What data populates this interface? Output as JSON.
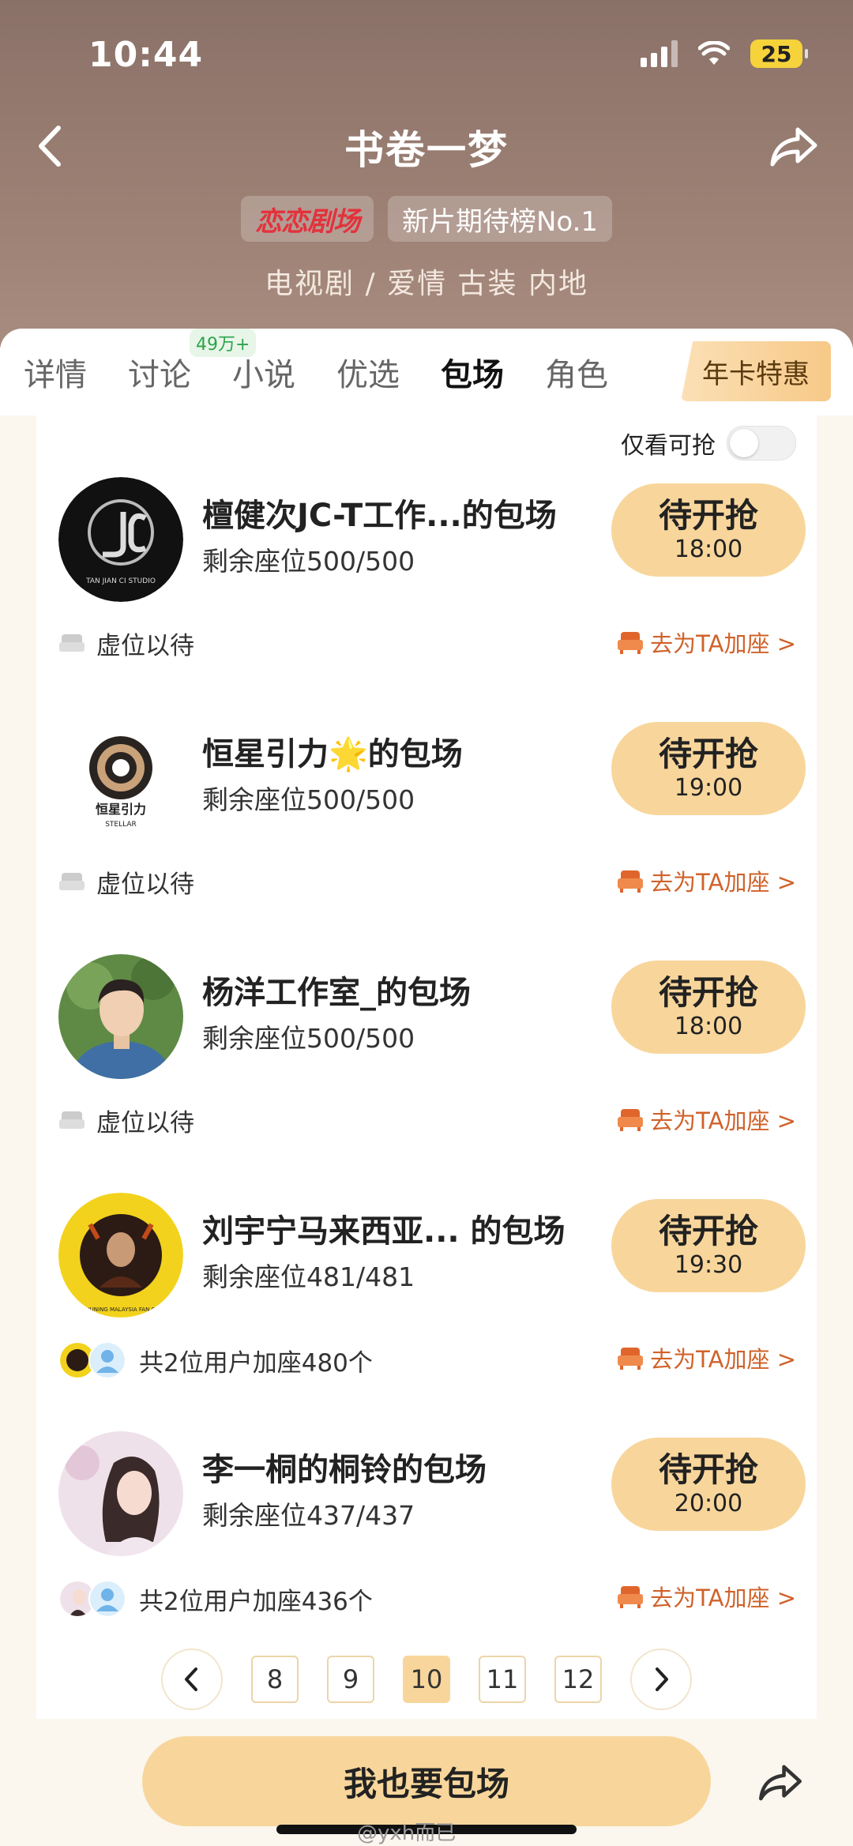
{
  "status": {
    "time": "10:44",
    "battery": "25"
  },
  "header": {
    "title": "书卷一梦",
    "brand_badge": "恋恋剧场",
    "rank_badge": "新片期待榜No.1",
    "genre": "电视剧 / 爱情 古装 内地"
  },
  "tabs": [
    {
      "label": "详情"
    },
    {
      "label": "讨论",
      "badge": "49万+"
    },
    {
      "label": "小说"
    },
    {
      "label": "优选"
    },
    {
      "label": "包场"
    },
    {
      "label": "角色"
    }
  ],
  "annual_card": "年卡特惠",
  "filter": {
    "label": "仅看可抢",
    "enabled": false
  },
  "rows": [
    {
      "name": "檀健次JC-T工作...的包场",
      "seats": "剩余座位500/500",
      "btn_label": "待开抢",
      "btn_time": "18:00",
      "bottom_text": "虚位以待",
      "join": "去为TA加座 >"
    },
    {
      "name": "恒星引力🌟的包场",
      "seats": "剩余座位500/500",
      "btn_label": "待开抢",
      "btn_time": "19:00",
      "bottom_text": "虚位以待",
      "join": "去为TA加座 >"
    },
    {
      "name": "杨洋工作室_的包场",
      "seats": "剩余座位500/500",
      "btn_label": "待开抢",
      "btn_time": "18:00",
      "bottom_text": "虚位以待",
      "join": "去为TA加座 >"
    },
    {
      "name": "刘宇宁马来西亚... 的包场",
      "seats": "剩余座位481/481",
      "btn_label": "待开抢",
      "btn_time": "19:30",
      "bottom_text": "共2位用户加座480个",
      "join": "去为TA加座 >"
    },
    {
      "name": "李一桐的桐铃的包场",
      "seats": "剩余座位437/437",
      "btn_label": "待开抢",
      "btn_time": "20:00",
      "bottom_text": "共2位用户加座436个",
      "join": "去为TA加座 >"
    }
  ],
  "avatar_texts": {
    "jc_sub": "TAN JIAN CI STUDIO",
    "stellar_cn": "恒星引力",
    "stellar_en": "STELLAR",
    "lyn_en": "LIU YUNING MALAYSIA FAN CLUB"
  },
  "pagination": [
    "8",
    "9",
    "10",
    "11",
    "12"
  ],
  "pagination_active": "10",
  "cta": {
    "label": "我也要包场"
  },
  "watermark": "@yxh而已",
  "colors": {
    "accent": "#f8d69b",
    "link": "#d0622a",
    "header": "#9b7f73"
  }
}
